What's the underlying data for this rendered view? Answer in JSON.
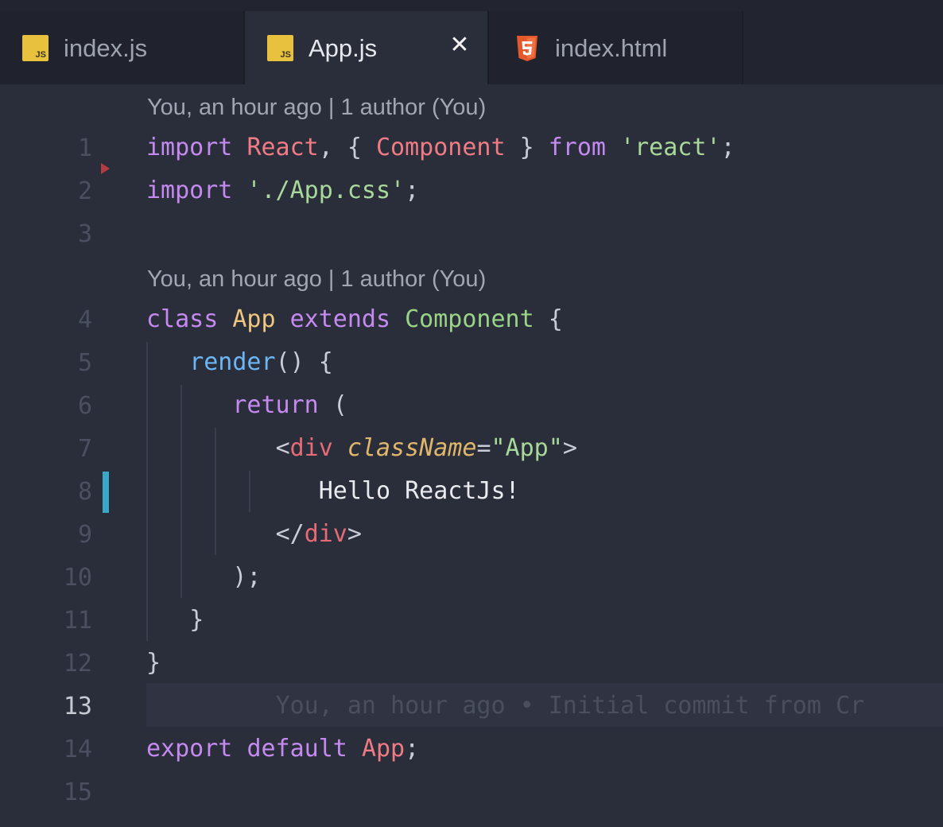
{
  "tabs": [
    {
      "label": "index.js",
      "icon": "js-file-icon",
      "icon_text": "JS",
      "active": false
    },
    {
      "label": "App.js",
      "icon": "js-file-icon",
      "icon_text": "JS",
      "active": true,
      "close": "✕"
    },
    {
      "label": "index.html",
      "icon": "html5-file-icon",
      "active": false
    }
  ],
  "codelens": [
    "You, an hour ago | 1 author (You)",
    "You, an hour ago | 1 author (You)"
  ],
  "line_numbers": [
    "1",
    "2",
    "3",
    "4",
    "5",
    "6",
    "7",
    "8",
    "9",
    "10",
    "11",
    "12",
    "13",
    "14",
    "15"
  ],
  "current_line": "13",
  "code": {
    "l1": {
      "kw1": "import",
      "name": "React",
      "p1": ", { ",
      "comp": "Component",
      "p2": " } ",
      "kw2": "from",
      "str": "'react'",
      "end": ";"
    },
    "l2": {
      "kw": "import",
      "str": "'./App.css'",
      "end": ";"
    },
    "l4": {
      "kw1": "class",
      "cls": "App",
      "kw2": "extends",
      "inh": "Component",
      "end": "{"
    },
    "l5": {
      "fn": "render",
      "end": "() {"
    },
    "l6": {
      "kw": "return",
      "end": "("
    },
    "l7": {
      "lt": "<",
      "tag": "div",
      "attr": "className",
      "eq": "=",
      "val": "\"App\"",
      "gt": ">"
    },
    "l8": {
      "text": "Hello ReactJs!"
    },
    "l9": {
      "lt": "</",
      "tag": "div",
      "gt": ">"
    },
    "l10": {
      "text": ");"
    },
    "l11": {
      "text": "}"
    },
    "l12": {
      "text": "}"
    },
    "l13": {
      "blame": "You, an hour ago • Initial commit from Cr"
    },
    "l14": {
      "kw1": "export",
      "kw2": "default",
      "name": "App",
      "end": ";"
    }
  },
  "colors": {
    "background": "#2a2d3a",
    "tabbar": "#22242f",
    "keyword": "#c58af0",
    "string": "#a8d99a",
    "modified_gutter": "#3aa6c8"
  }
}
